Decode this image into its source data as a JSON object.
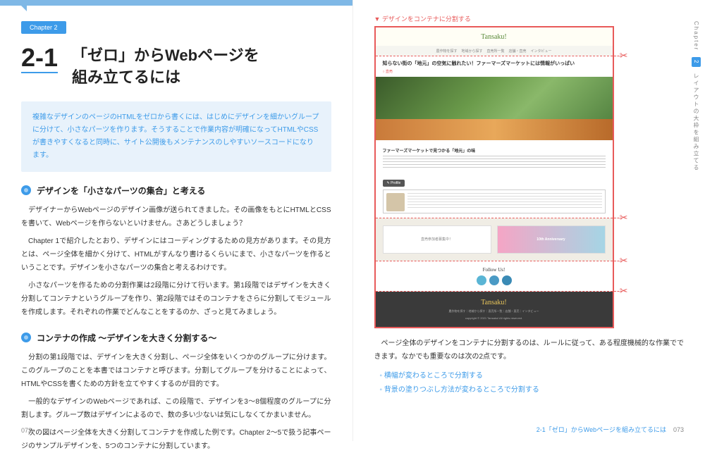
{
  "chapter_badge": "Chapter 2",
  "section_number": "2-1",
  "section_title_line1": "「ゼロ」からWebページを",
  "section_title_line2": "組み立てるには",
  "intro": "複雑なデザインのページのHTMLをゼロから書くには、はじめにデザインを細かいグループに分けて、小さなパーツを作ります。そうすることで作業内容が明確になってHTMLやCSSが書きやすくなると同時に、サイト公開後もメンテナンスのしやすいソースコードになります。",
  "sub1": "デザインを「小さなパーツの集合」と考える",
  "p1a": "デザイナーからWebページのデザイン画像が送られてきました。その画像をもとにHTMLとCSSを書いて、Webページを作らないといけません。さあどうしましょう？",
  "p1b": "Chapter 1で紹介したとおり、デザインにはコーディングするための見方があります。その見方とは、ページ全体を細かく分けて、HTMLがすんなり書けるくらいにまで、小さなパーツを作るということです。デザインを小さなパーツの集合と考えるわけです。",
  "p1c": "小さなパーツを作るための分割作業は2段階に分けて行います。第1段階ではデザインを大きく分割してコンテナというグループを作り、第2段階ではそのコンテナをさらに分割してモジュールを作成します。それぞれの作業でどんなことをするのか、ざっと見てみましょう。",
  "sub2": "コンテナの作成 〜デザインを大きく分割する〜",
  "p2a": "分割の第1段階では、デザインを大きく分割し、ページ全体をいくつかのグループに分けます。このグループのことを本書ではコンテナと呼びます。分割してグループを分けることによって、HTMLやCSSを書くための方針を立てやすくするのが目的です。",
  "p2b": "一般的なデザインのWebページであれば、この段階で、デザインを3〜8個程度のグループに分割します。グループ数はデザインによるので、数の多い少ないは気にしなくてかまいません。",
  "p2c": "次の図はページ全体を大きく分割してコンテナを作成した例です。Chapter 2〜5で扱う記事ページのサンプルデザインを、5つのコンテナに分割しています。",
  "fig_caption": "デザインをコンテナに分割する",
  "mock": {
    "logo": "Tansaku!",
    "nav": [
      "農作物を探す",
      "地域から探す",
      "直売所一覧",
      "店舗・直売",
      "インタビュー"
    ],
    "hero_title": "知らない街の「地元」の空気に触れたい！ファーマーズマーケットには情報がいっぱい",
    "hero_sub": "○ 直売",
    "article_h": "ファーマーズマーケットで見つかる「地元」の味",
    "profile_btn": "✎ Profile",
    "promo1": "直売参加者募集中！",
    "promo2": "10th Anniversary",
    "follow": "Follow Us!",
    "footer_logo": "Tansaku!",
    "footer_links": "農作物を探す｜地域から探す｜直売所一覧｜店舗・直売｜インタビュー",
    "footer_copy": "copyright © 2021 Tansaku! All rights reserved."
  },
  "right_p1": "ページ全体のデザインをコンテナに分割するのは、ルールに従って、ある程度機械的な作業でできます。なかでも重要なのは次の2点です。",
  "bullet1": "横幅が変わるところで分割する",
  "bullet2": "背景の塗りつぶし方法が変わるところで分割する",
  "page_left_num": "072",
  "page_right_section": "2-1「ゼロ」からWebページを組み立てるには",
  "page_right_num": "073",
  "side_chapter": "Chapter",
  "side_num": "2",
  "side_label": "レイアウトの大枠を組み立てる"
}
